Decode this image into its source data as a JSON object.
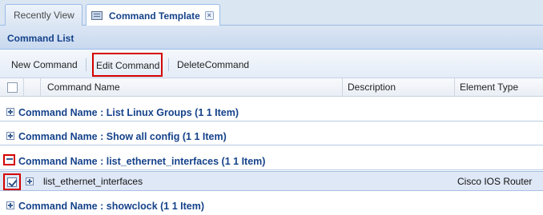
{
  "tabs": [
    {
      "label": "Recently View",
      "active": false
    },
    {
      "label": "Command Template",
      "active": true,
      "icon": "window-icon"
    }
  ],
  "panel": {
    "title": "Command List"
  },
  "toolbar": {
    "new_label": "New Command",
    "edit_label": "Edit Command",
    "delete_label": "DeleteCommand"
  },
  "columns": [
    "Command Name",
    "Description",
    "Element Type"
  ],
  "groups": [
    {
      "label": "Command Name : List Linux Groups (1 1 Item)",
      "expanded": false
    },
    {
      "label": "Command Name : Show all config (1 1 Item)",
      "expanded": false
    },
    {
      "label": "Command Name : list_ethernet_interfaces (1 1 Item)",
      "expanded": true
    },
    {
      "label": "Command Name : showclock (1 1 Item)",
      "expanded": false
    }
  ],
  "row": {
    "name": "list_ethernet_interfaces",
    "description": "",
    "element_type": "Cisco IOS Router",
    "checked": true
  },
  "colors": {
    "accent": "#15428b",
    "highlight": "#d40000",
    "selected_row": "#dfe8f6"
  }
}
